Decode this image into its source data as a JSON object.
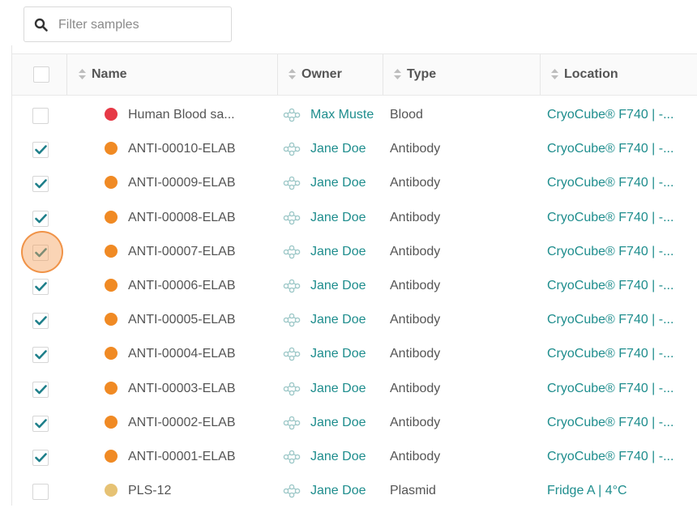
{
  "filter": {
    "placeholder": "Filter samples",
    "value": ""
  },
  "columns": {
    "name": "Name",
    "owner": "Owner",
    "type": "Type",
    "location": "Location"
  },
  "colors": {
    "accent": "#1e8d8d",
    "checkmark": "#1e7f8a"
  },
  "rows": [
    {
      "checked": false,
      "dot": "#e63946",
      "name": "Human Blood sa...",
      "owner": "Max Muste",
      "type": "Blood",
      "location": "CryoCube® F740 | -..."
    },
    {
      "checked": true,
      "dot": "#f08a24",
      "name": "ANTI-00010-ELAB",
      "owner": "Jane Doe",
      "type": "Antibody",
      "location": "CryoCube® F740 | -..."
    },
    {
      "checked": true,
      "dot": "#f08a24",
      "name": "ANTI-00009-ELAB",
      "owner": "Jane Doe",
      "type": "Antibody",
      "location": "CryoCube® F740 | -..."
    },
    {
      "checked": true,
      "dot": "#f08a24",
      "name": "ANTI-00008-ELAB",
      "owner": "Jane Doe",
      "type": "Antibody",
      "location": "CryoCube® F740 | -..."
    },
    {
      "checked": true,
      "dot": "#f08a24",
      "name": "ANTI-00007-ELAB",
      "owner": "Jane Doe",
      "type": "Antibody",
      "location": "CryoCube® F740 | -..."
    },
    {
      "checked": true,
      "dot": "#f08a24",
      "name": "ANTI-00006-ELAB",
      "owner": "Jane Doe",
      "type": "Antibody",
      "location": "CryoCube® F740 | -..."
    },
    {
      "checked": true,
      "dot": "#f08a24",
      "name": "ANTI-00005-ELAB",
      "owner": "Jane Doe",
      "type": "Antibody",
      "location": "CryoCube® F740 | -..."
    },
    {
      "checked": true,
      "dot": "#f08a24",
      "name": "ANTI-00004-ELAB",
      "owner": "Jane Doe",
      "type": "Antibody",
      "location": "CryoCube® F740 | -..."
    },
    {
      "checked": true,
      "dot": "#f08a24",
      "name": "ANTI-00003-ELAB",
      "owner": "Jane Doe",
      "type": "Antibody",
      "location": "CryoCube® F740 | -..."
    },
    {
      "checked": true,
      "dot": "#f08a24",
      "name": "ANTI-00002-ELAB",
      "owner": "Jane Doe",
      "type": "Antibody",
      "location": "CryoCube® F740 | -..."
    },
    {
      "checked": true,
      "dot": "#f08a24",
      "name": "ANTI-00001-ELAB",
      "owner": "Jane Doe",
      "type": "Antibody",
      "location": "CryoCube® F740 | -..."
    },
    {
      "checked": false,
      "dot": "#e6c274",
      "name": "PLS-12",
      "owner": "Jane Doe",
      "type": "Plasmid",
      "location": "Fridge A | 4°C"
    }
  ]
}
